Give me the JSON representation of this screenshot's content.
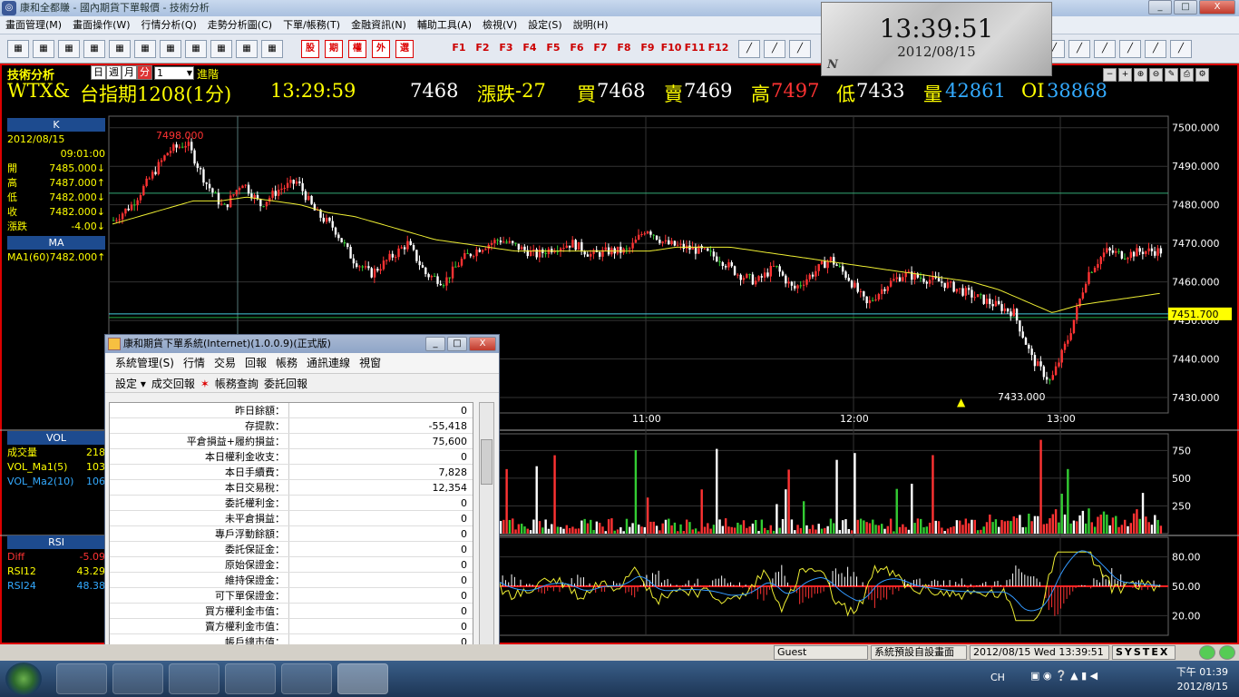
{
  "window": {
    "title": "康和全都賺 - 國內期貨下單報價 - 技術分析",
    "min": "_",
    "max": "□",
    "close": "X"
  },
  "menu": [
    "畫面管理(M)",
    "畫面操作(W)",
    "行情分析(Q)",
    "走勢分析圖(C)",
    "下單/帳務(T)",
    "金融資訊(N)",
    "輔助工具(A)",
    "檢視(V)",
    "設定(S)",
    "說明(H)"
  ],
  "toolbar": {
    "redbuttons": [
      "股",
      "期",
      "權",
      "外",
      "選"
    ],
    "fkeys": [
      "F1",
      "F2",
      "F3",
      "F4",
      "F5",
      "F6",
      "F7",
      "F8",
      "F9",
      "F10",
      "F11",
      "F12"
    ]
  },
  "clock": {
    "time": "13:39:51",
    "date": "2012/08/15",
    "mark": "N"
  },
  "chart_header": {
    "panel": "技術分析",
    "tabs": [
      "日",
      "週",
      "月",
      "分"
    ],
    "selected_tab": "分",
    "period": "1",
    "advance": "進階"
  },
  "quote": {
    "symbol": "WTX&",
    "name": "台指期1208(1分)",
    "time": "13:29:59",
    "price": "7468",
    "change_label": "漲跌",
    "change": "-27",
    "bid_label": "買",
    "bid": "7468",
    "ask_label": "賣",
    "ask": "7469",
    "high_label": "高",
    "high": "7497",
    "low_label": "低",
    "low": "7433",
    "vol_label": "量",
    "volume": "42861",
    "oi_label": "OI",
    "oi": "38868"
  },
  "side_k": {
    "header": "K",
    "date": "2012/08/15",
    "time": "09:01:00",
    "rows": [
      {
        "k": "開",
        "v": "7485.000↓"
      },
      {
        "k": "高",
        "v": "7487.000↑"
      },
      {
        "k": "低",
        "v": "7482.000↓"
      },
      {
        "k": "收",
        "v": "7482.000↓"
      },
      {
        "k": "漲跌",
        "v": "-4.00↓"
      }
    ]
  },
  "side_ma": {
    "header": "MA",
    "label": "MA1(60)",
    "value": "7482.000↑"
  },
  "side_vol": {
    "header": "VOL",
    "rows": [
      {
        "k": "成交量",
        "v": "218",
        "c": "#ff0"
      },
      {
        "k": "VOL_Ma1(5)",
        "v": "103",
        "c": "#ff0"
      },
      {
        "k": "VOL_Ma2(10)",
        "v": "106",
        "c": "#3af"
      }
    ]
  },
  "side_rsi": {
    "header": "RSI",
    "rows": [
      {
        "k": "Diff",
        "v": "-5.09",
        "c": "#f33"
      },
      {
        "k": "RSI12",
        "v": "43.29",
        "c": "#ff0"
      },
      {
        "k": "RSI24",
        "v": "48.38",
        "c": "#3af"
      }
    ]
  },
  "chart_data": {
    "type": "candlestick",
    "price_axis": {
      "ticks": [
        "7500.000",
        "7490.000",
        "7480.000",
        "7470.000",
        "7460.000",
        "7450.000",
        "7440.000",
        "7430.000"
      ],
      "min": 7426,
      "max": 7503
    },
    "time_ticks": [
      "11:00",
      "12:00",
      "13:00"
    ],
    "max_label": "7498.000",
    "min_label": "7433.000",
    "last_label": "7451.700",
    "volume_ticks": [
      "750",
      "500",
      "250"
    ],
    "rsi_ticks": [
      "80.00",
      "50.00",
      "20.00"
    ],
    "anchor_prices": [
      7476,
      7480,
      7487,
      7494,
      7496,
      7486,
      7479,
      7486,
      7480,
      7484,
      7486,
      7478,
      7474,
      7466,
      7462,
      7466,
      7470,
      7462,
      7460,
      7466,
      7469,
      7471,
      7469,
      7467,
      7469,
      7470,
      7467,
      7468,
      7468,
      7474,
      7470,
      7469,
      7468,
      7466,
      7462,
      7460,
      7464,
      7458,
      7462,
      7466,
      7461,
      7454,
      7459,
      7462,
      7461,
      7460,
      7458,
      7456,
      7454,
      7452,
      7440,
      7434,
      7446,
      7462,
      7468,
      7467,
      7468,
      7468
    ],
    "ma60_anchor": [
      7475,
      7477,
      7479,
      7481,
      7481,
      7482,
      7481,
      7480,
      7478,
      7477,
      7475,
      7473,
      7471,
      7470,
      7469,
      7468,
      7468,
      7468,
      7468,
      7468,
      7468,
      7469,
      7469,
      7469,
      7468,
      7467,
      7466,
      7465,
      7464,
      7463,
      7462,
      7461,
      7460,
      7458,
      7455,
      7452,
      7454,
      7455,
      7456,
      7457
    ]
  },
  "order_window": {
    "title": "康和期貨下單系統(Internet)(1.0.0.9)(正式版)",
    "menu": [
      "系統管理(S)",
      "行情",
      "交易",
      "回報",
      "帳務",
      "通訊連線",
      "視窗"
    ],
    "tools": [
      "設定 ▾",
      "成交回報",
      "帳務查詢",
      "委託回報"
    ],
    "rows": [
      {
        "k": "昨日餘額：",
        "v": "0"
      },
      {
        "k": "存提款：",
        "v": "-55,418"
      },
      {
        "k": "平倉損益+履約損益：",
        "v": "75,600"
      },
      {
        "k": "本日權利金收支：",
        "v": "0"
      },
      {
        "k": "本日手續費：",
        "v": "7,828"
      },
      {
        "k": "本日交易稅：",
        "v": "12,354"
      },
      {
        "k": "委託權利金：",
        "v": "0"
      },
      {
        "k": "未平倉損益：",
        "v": "0"
      },
      {
        "k": "專戶浮動餘額：",
        "v": "0"
      },
      {
        "k": "委託保証金：",
        "v": "0"
      },
      {
        "k": "原始保證金：",
        "v": "0"
      },
      {
        "k": "維持保證金：",
        "v": "0"
      },
      {
        "k": "可下單保證金：",
        "v": "0"
      },
      {
        "k": "買方權利金市值：",
        "v": "0"
      },
      {
        "k": "賣方權利金市值：",
        "v": "0"
      },
      {
        "k": "帳戶總市值：",
        "v": "0"
      }
    ]
  },
  "statusbar": {
    "user": "Guest",
    "layout": "系統預設自設畫面",
    "datetime": "2012/08/15 Wed 13:39:51",
    "brand": "SYSTEX"
  },
  "tray": {
    "lang": "CH",
    "time": "下午 01:39",
    "date": "2012/8/15"
  }
}
